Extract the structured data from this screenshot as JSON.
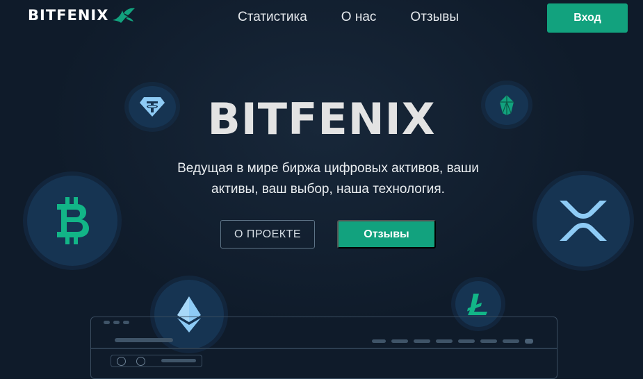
{
  "header": {
    "logo_text": "BITFENIX",
    "nav": [
      {
        "label": "Статистика"
      },
      {
        "label": "О нас"
      },
      {
        "label": "Отзывы"
      }
    ],
    "login_label": "Вход"
  },
  "hero": {
    "title": "BITFENIX",
    "subtitle_line1": "Ведущая в мире биржа цифровых активов, ваши",
    "subtitle_line2": "активы, ваш выбор, наша технология.",
    "about_label": "О ПРОЕКТЕ",
    "reviews_label": "Отзывы"
  },
  "coins": [
    "tether-icon",
    "eos-icon",
    "bitcoin-icon",
    "xrp-icon",
    "ethereum-icon",
    "litecoin-icon"
  ],
  "colors": {
    "background": "#0f1b2a",
    "accent": "#12a27e",
    "coin_bg": "#163452",
    "coin_light": "#8ecbf5"
  }
}
